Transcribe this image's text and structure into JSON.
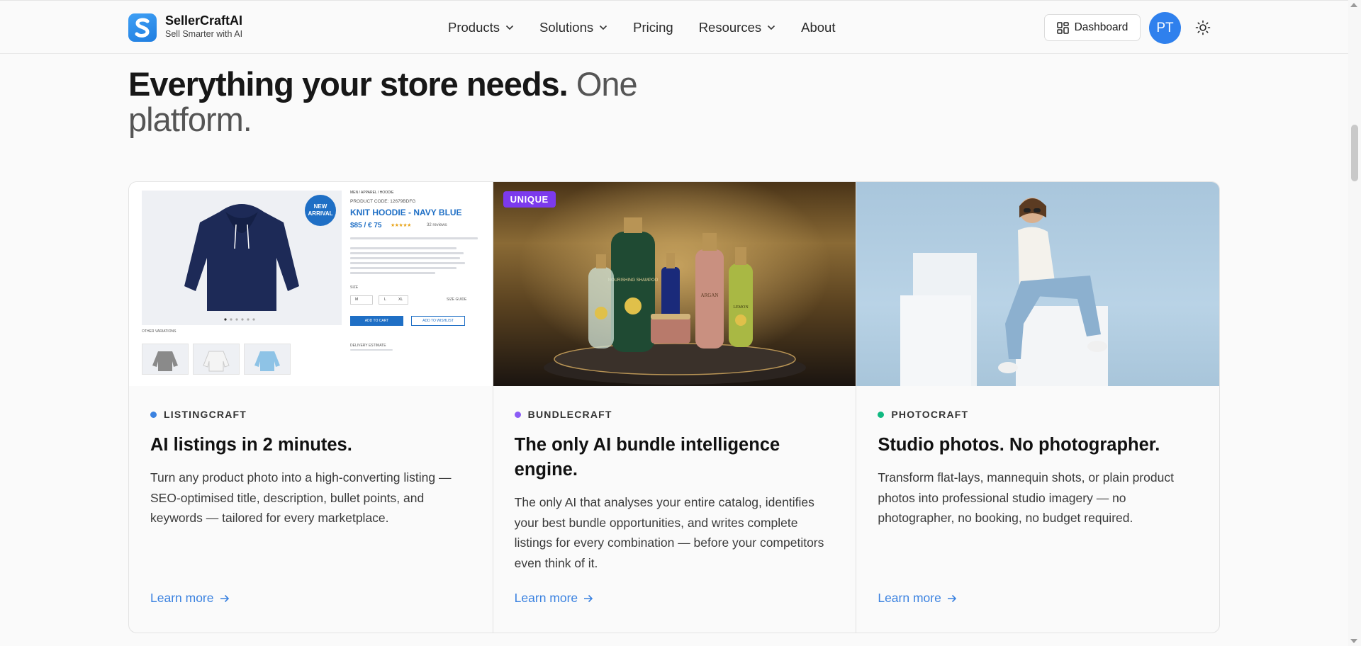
{
  "brand": {
    "name": "SellerCraftAI",
    "tagline": "Sell Smarter with AI"
  },
  "nav": [
    {
      "label": "Products",
      "has_dropdown": true
    },
    {
      "label": "Solutions",
      "has_dropdown": true
    },
    {
      "label": "Pricing",
      "has_dropdown": false
    },
    {
      "label": "Resources",
      "has_dropdown": true
    },
    {
      "label": "About",
      "has_dropdown": false
    }
  ],
  "header_actions": {
    "dashboard_label": "Dashboard",
    "avatar_initials": "PT",
    "theme_icon": "sun-icon"
  },
  "heading": {
    "strong": "Everything your store needs.",
    "light": "One platform."
  },
  "colors": {
    "accent": "#3b82e0",
    "avatar": "#2f80ed",
    "unique_badge": "#7c3aed",
    "dot_listing": "#3b82e0",
    "dot_bundle": "#8b5cf6",
    "dot_photo": "#10b981"
  },
  "cards": [
    {
      "eyebrow": "LISTINGCRAFT",
      "title": "AI listings in 2 minutes.",
      "description": "Turn any product photo into a high-converting listing — SEO-optimised title, description, bullet points, and keywords — tailored for every marketplace.",
      "link": "Learn more",
      "image": {
        "badge": "NEW ARRIVAL",
        "breadcrumb": "MEN / APPAREL / HOODIE",
        "product_code": "PRODUCT CODE: 12679BDFG",
        "product_title": "KNIT HOODIE - NAVY BLUE",
        "price": "$85 / € 75",
        "reviews": "32 reviews",
        "size_label": "SIZE",
        "size_guide": "SIZE GUIDE",
        "size_m": "M",
        "size_l": "L",
        "size_xl": "XL",
        "add_to_cart": "ADD TO CART",
        "add_to_wishlist": "ADD TO WISHLIST",
        "other_variations": "OTHER VARIATIONS",
        "delivery": "DELIVERY ESTIMATE"
      }
    },
    {
      "eyebrow": "BUNDLECRAFT",
      "title": "The only AI bundle intelligence engine.",
      "description": "The only AI that analyses your entire catalog, identifies your best bundle opportunities, and writes complete listings for every combination — before your competitors even think of it.",
      "link": "Learn more",
      "badge": "UNIQUE",
      "image": {
        "label_shampoo": "NOURISHING SHAMPOO",
        "label_argan": "ARGAN",
        "label_lemon": "LEMON"
      }
    },
    {
      "eyebrow": "PHOTOCRAFT",
      "title": "Studio photos. No photographer.",
      "description": "Transform flat-lays, mannequin shots, or plain product photos into professional studio imagery — no photographer, no booking, no budget required.",
      "link": "Learn more"
    }
  ]
}
